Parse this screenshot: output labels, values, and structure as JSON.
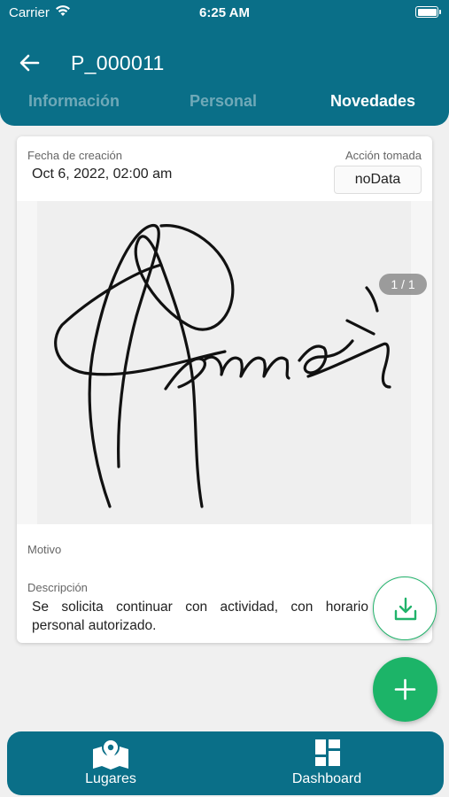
{
  "status_bar": {
    "carrier": "Carrier",
    "time": "6:25 AM"
  },
  "header": {
    "title": "P_000011"
  },
  "tabs": [
    {
      "label": "Información",
      "active": false
    },
    {
      "label": "Personal",
      "active": false
    },
    {
      "label": "Novedades",
      "active": true
    }
  ],
  "card": {
    "fecha_label": "Fecha de creación",
    "fecha_value": "Oct 6, 2022, 02:00 am",
    "accion_label": "Acción tomada",
    "accion_value": "noData",
    "page_counter": "1 / 1",
    "motivo_label": "Motivo",
    "descripcion_label": "Descripción",
    "descripcion_value": "Se solicita continuar con actividad, con horario personal autorizado."
  },
  "bottom_nav": [
    {
      "label": "Lugares",
      "icon": "map-pin-icon"
    },
    {
      "label": "Dashboard",
      "icon": "dashboard-grid-icon"
    }
  ],
  "colors": {
    "primary": "#0a6f88",
    "accent_green": "#1cb468",
    "tab_inactive": "#6fa9b8"
  }
}
